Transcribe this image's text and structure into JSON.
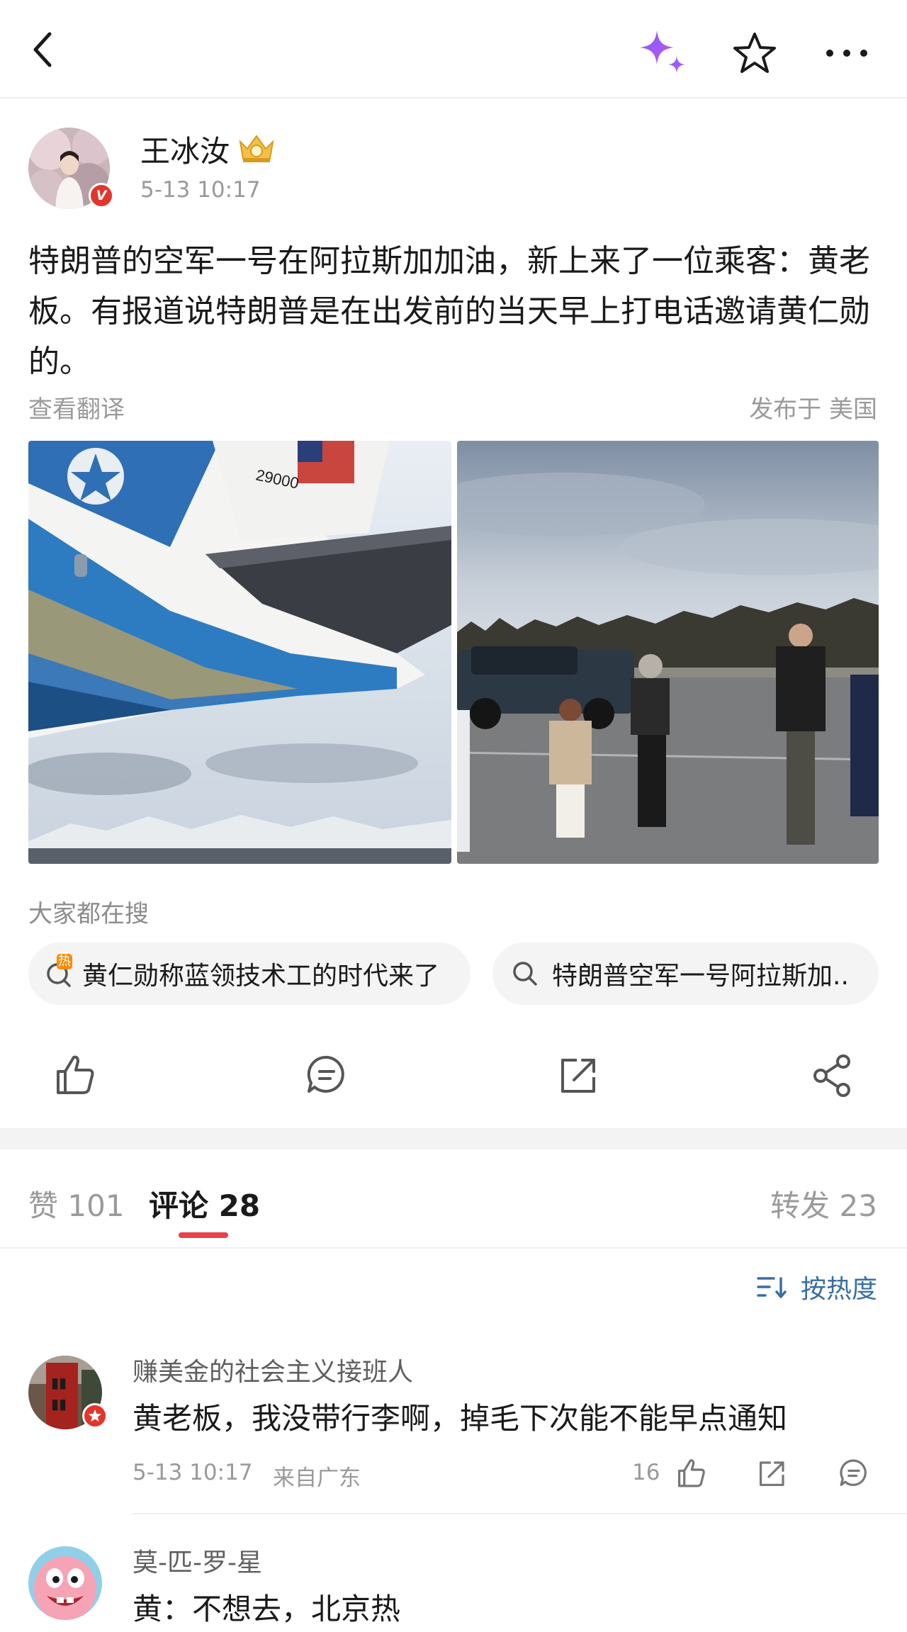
{
  "topbar": {
    "back_icon": "chevron-left-icon",
    "sparkle_icon": "sparkle-ai-icon",
    "star_icon": "star-outline-icon",
    "more_icon": "more-horizontal-icon",
    "sparkle_colors": [
      "#7c5cff",
      "#c158f0"
    ]
  },
  "post": {
    "author": "王冰汝",
    "verified_badge": "V",
    "time": "5-13 10:17",
    "text": "特朗普的空军一号在阿拉斯加加油，新上来了一位乘客：黄老板。有报道说特朗普是在出发前的当天早上打电话邀请黄仁勋的。",
    "translate_label": "查看翻译",
    "location_label": "发布于 美国",
    "image_left_text": "29000"
  },
  "trending": {
    "title": "大家都在搜",
    "hot_badge": "热",
    "items": [
      {
        "text": "黄仁勋称蓝领技术工的时代来了",
        "icon": "hot-search-icon"
      },
      {
        "text": "特朗普空军一号阿拉斯加..",
        "icon": "search-icon"
      }
    ]
  },
  "actions": {
    "icons": [
      "like-icon",
      "comment-icon",
      "repost-icon",
      "share-icon"
    ]
  },
  "tabs": {
    "likes_label": "赞",
    "likes_count": "101",
    "comments_label": "评论",
    "comments_count": "28",
    "reposts_label": "转发",
    "reposts_count": "23",
    "active_color": "#e8414a"
  },
  "sort": {
    "label": "按热度",
    "icon": "sort-icon",
    "color": "#3a6ea5"
  },
  "comments": [
    {
      "name": "赚美金的社会主义接班人",
      "text": "黄老板，我没带行李啊，掉毛下次能不能早点通知",
      "time": "5-13 10:17",
      "source": "来自广东",
      "likes": "16"
    },
    {
      "name": "莫-匹-罗-星",
      "text": "黄：不想去，北京热"
    }
  ]
}
